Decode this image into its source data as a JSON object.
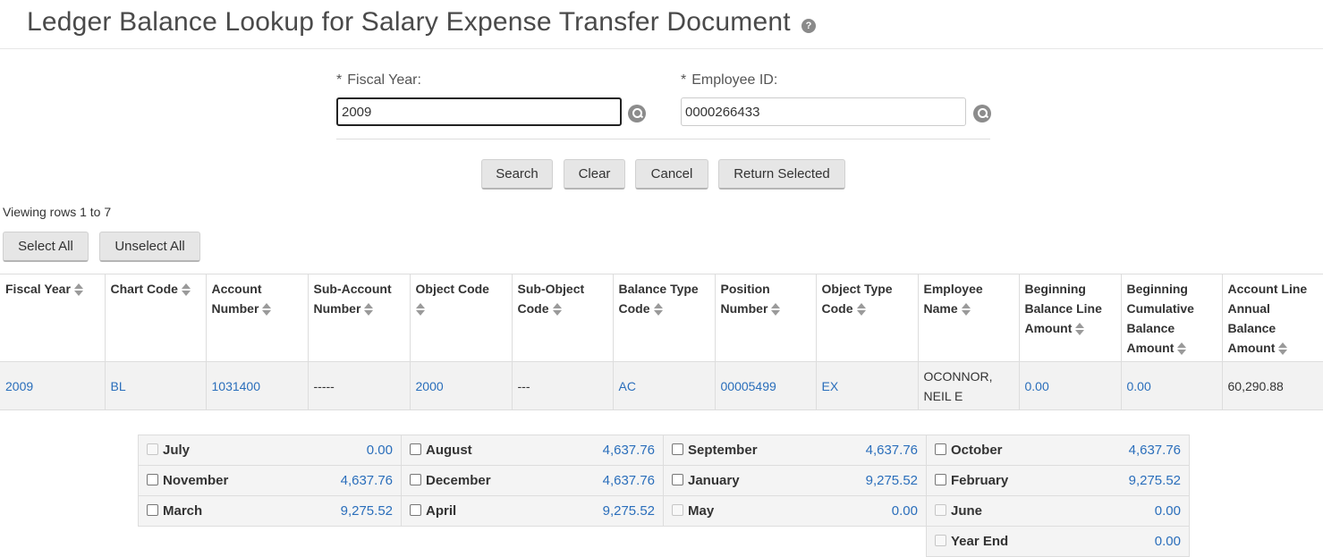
{
  "page": {
    "title": "Ledger Balance Lookup for Salary Expense Transfer Document",
    "help_icon": "question-circle-icon"
  },
  "form": {
    "fiscal_year": {
      "required_mark": "*",
      "label": "Fiscal Year:",
      "value": "2009"
    },
    "employee_id": {
      "required_mark": "*",
      "label": "Employee ID:",
      "value": "0000266433"
    },
    "buttons": {
      "search": "Search",
      "clear": "Clear",
      "cancel": "Cancel",
      "return_selected": "Return Selected"
    }
  },
  "results": {
    "viewing_text": "Viewing rows 1 to 7",
    "select_all": "Select All",
    "unselect_all": "Unselect All",
    "columns": [
      "Fiscal Year",
      "Chart Code",
      "Account Number",
      "Sub-Account Number",
      "Object Code",
      "Sub-Object Code",
      "Balance Type Code",
      "Position Number",
      "Object Type Code",
      "Employee Name",
      "Beginning Balance Line Amount",
      "Beginning Cumulative Balance Amount",
      "Account Line Annual Balance Amount"
    ],
    "rows": [
      {
        "fiscal_year": "2009",
        "chart_code": "BL",
        "account_number": "1031400",
        "sub_account_number": "-----",
        "object_code": "2000",
        "sub_object_code": "---",
        "balance_type_code": "AC",
        "position_number": "00005499",
        "object_type_code": "EX",
        "employee_name": "OCONNOR, NEIL E",
        "beginning_balance_line_amount": "0.00",
        "beginning_cumulative_balance_amount": "0.00",
        "account_line_annual_balance_amount": "60,290.88"
      }
    ]
  },
  "months": [
    {
      "label": "July",
      "value": "0.00",
      "enabled": false
    },
    {
      "label": "August",
      "value": "4,637.76",
      "enabled": true
    },
    {
      "label": "September",
      "value": "4,637.76",
      "enabled": true
    },
    {
      "label": "October",
      "value": "4,637.76",
      "enabled": true
    },
    {
      "label": "November",
      "value": "4,637.76",
      "enabled": true
    },
    {
      "label": "December",
      "value": "4,637.76",
      "enabled": true
    },
    {
      "label": "January",
      "value": "9,275.52",
      "enabled": true
    },
    {
      "label": "February",
      "value": "9,275.52",
      "enabled": true
    },
    {
      "label": "March",
      "value": "9,275.52",
      "enabled": true
    },
    {
      "label": "April",
      "value": "9,275.52",
      "enabled": true
    },
    {
      "label": "May",
      "value": "0.00",
      "enabled": false
    },
    {
      "label": "June",
      "value": "0.00",
      "enabled": false
    },
    {
      "label": "Year End",
      "value": "0.00",
      "enabled": false
    }
  ],
  "colors": {
    "link": "#2a6ebb",
    "row_bg": "#f2f2f2"
  }
}
